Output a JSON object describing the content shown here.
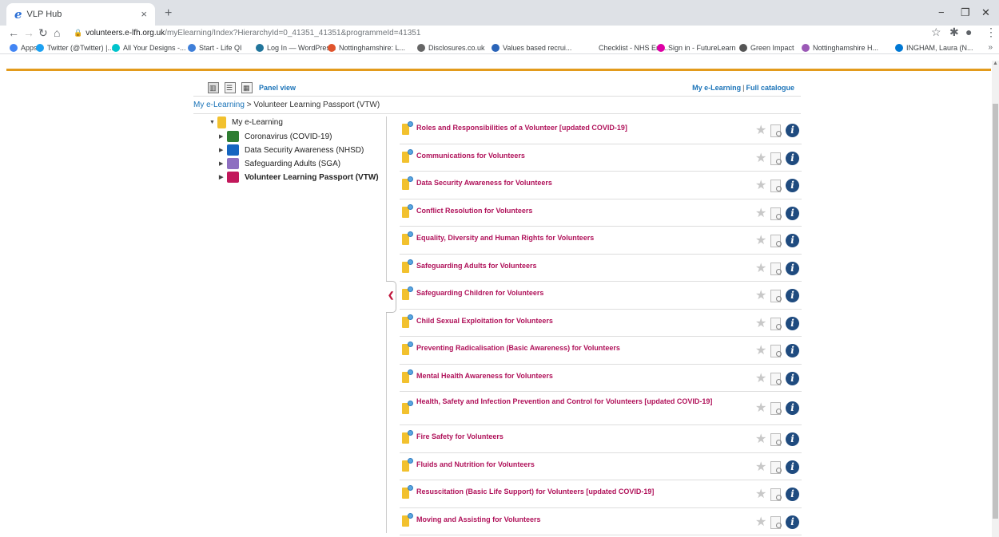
{
  "browser": {
    "tab_title": "VLP Hub",
    "tab_close": "×",
    "new_tab": "+",
    "url_host": "volunteers.e-lfh.org.uk",
    "url_path": "/myElearning/Index?HierarchyId=0_41351_41351&programmeId=41351",
    "bookmarks": [
      {
        "label": "Apps",
        "color": "#4285f4"
      },
      {
        "label": "Twitter (@Twitter) |...",
        "color": "#1da1f2"
      },
      {
        "label": "All Your Designs -...",
        "color": "#00c4cc"
      },
      {
        "label": "Start - Life QI",
        "color": "#3f7fd9"
      },
      {
        "label": "Log In — WordPres...",
        "color": "#21759b"
      },
      {
        "label": "Nottinghamshire: L...",
        "color": "#e0542c"
      },
      {
        "label": "Disclosures.co.uk",
        "color": "#666666"
      },
      {
        "label": "Values based recrui...",
        "color": "#2a64b8"
      },
      {
        "label": "Checklist - NHS Em...",
        "color": "#ffffff"
      },
      {
        "label": "Sign in - FutureLearn",
        "color": "#de00a5"
      },
      {
        "label": "Green Impact",
        "color": "#555555"
      },
      {
        "label": "Nottinghamshire H...",
        "color": "#9b59b6"
      },
      {
        "label": "INGHAM, Laura (N...",
        "color": "#0078d4"
      }
    ],
    "bookmarks_more": "»"
  },
  "toolbar": {
    "panel_view_label": "Panel view",
    "my_elearning_link": "My e-Learning",
    "link_separator": "|",
    "full_catalogue_link": "Full catalogue"
  },
  "breadcrumb": {
    "root": "My e-Learning",
    "separator": " > ",
    "current": "Volunteer Learning Passport (VTW)"
  },
  "tree": {
    "root": {
      "label": "My e-Learning",
      "icon": "folder-icon",
      "color": "#f2c12e"
    },
    "items": [
      {
        "label": "Coronavirus (COVID-19)",
        "icon": "virus-icon",
        "color": "#2e7d32"
      },
      {
        "label": "Data Security Awareness (NHSD)",
        "icon": "security-icon",
        "color": "#1565c0"
      },
      {
        "label": "Safeguarding Adults (SGA)",
        "icon": "safeguarding-icon",
        "color": "#8e6fc1"
      },
      {
        "label": "Volunteer Learning Passport (VTW)",
        "icon": "passport-icon",
        "color": "#c2185b"
      }
    ]
  },
  "courses": [
    {
      "title": "Roles and Responsibilities of a Volunteer [updated COVID-19]"
    },
    {
      "title": "Communications for Volunteers"
    },
    {
      "title": "Data Security Awareness for Volunteers"
    },
    {
      "title": "Conflict Resolution for Volunteers"
    },
    {
      "title": "Equality, Diversity and Human Rights for Volunteers"
    },
    {
      "title": "Safeguarding Adults for Volunteers"
    },
    {
      "title": "Safeguarding Children for Volunteers"
    },
    {
      "title": "Child Sexual Exploitation for Volunteers"
    },
    {
      "title": "Preventing Radicalisation (Basic Awareness) for Volunteers"
    },
    {
      "title": "Mental Health Awareness for Volunteers"
    },
    {
      "title": "Health, Safety and Infection Prevention and Control for Volunteers [updated COVID-19]"
    },
    {
      "title": "Fire Safety for Volunteers"
    },
    {
      "title": "Fluids and Nutrition for Volunteers"
    },
    {
      "title": "Resuscitation (Basic Life Support) for Volunteers [updated COVID-19]"
    },
    {
      "title": "Moving and Assisting for Volunteers"
    }
  ],
  "colors": {
    "accent_orange": "#e39b1c",
    "course_title": "#b0125a",
    "link_blue": "#1a73b8"
  }
}
